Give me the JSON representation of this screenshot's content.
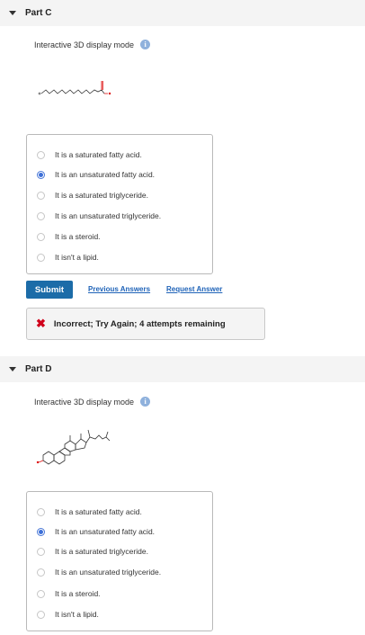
{
  "part_c": {
    "title": "Part C",
    "mode_label": "Interactive 3D display mode",
    "choices": [
      {
        "label": "It is a saturated fatty acid.",
        "selected": false
      },
      {
        "label": "It is an unsaturated fatty acid.",
        "selected": true
      },
      {
        "label": "It is a saturated triglyceride.",
        "selected": false
      },
      {
        "label": "It is an unsaturated triglyceride.",
        "selected": false
      },
      {
        "label": "It is a steroid.",
        "selected": false
      },
      {
        "label": "It isn't a lipid.",
        "selected": false
      }
    ],
    "submit_label": "Submit",
    "previous_answers_label": "Previous Answers",
    "request_answer_label": "Request Answer",
    "feedback": "Incorrect; Try Again; 4 attempts remaining"
  },
  "part_d": {
    "title": "Part D",
    "mode_label": "Interactive 3D display mode",
    "choices": [
      {
        "label": "It is a saturated fatty acid.",
        "selected": false
      },
      {
        "label": "It is an unsaturated fatty acid.",
        "selected": true
      },
      {
        "label": "It is a saturated triglyceride.",
        "selected": false
      },
      {
        "label": "It is an unsaturated triglyceride.",
        "selected": false
      },
      {
        "label": "It is a steroid.",
        "selected": false
      },
      {
        "label": "It isn't a lipid.",
        "selected": false
      }
    ]
  },
  "colors": {
    "accent": "#1c6ca8",
    "link": "#1f63b8",
    "error": "#d0021b",
    "radio_selected": "#3d6fd8"
  },
  "icons": {
    "collapse": "triangle-down-icon",
    "info": "info-icon",
    "error": "x-icon"
  }
}
